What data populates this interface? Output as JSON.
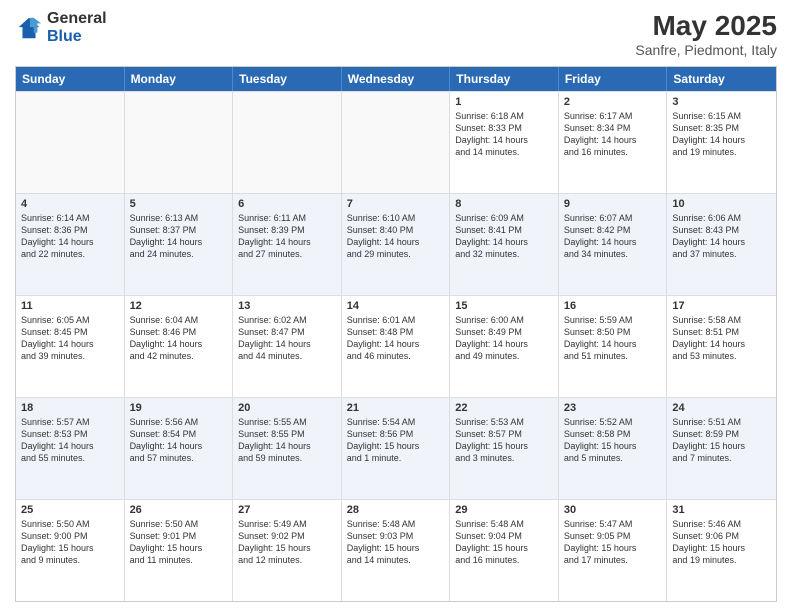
{
  "logo": {
    "general": "General",
    "blue": "Blue"
  },
  "title": "May 2025",
  "subtitle": "Sanfre, Piedmont, Italy",
  "headers": [
    "Sunday",
    "Monday",
    "Tuesday",
    "Wednesday",
    "Thursday",
    "Friday",
    "Saturday"
  ],
  "rows": [
    [
      {
        "day": "",
        "text": ""
      },
      {
        "day": "",
        "text": ""
      },
      {
        "day": "",
        "text": ""
      },
      {
        "day": "",
        "text": ""
      },
      {
        "day": "1",
        "text": "Sunrise: 6:18 AM\nSunset: 8:33 PM\nDaylight: 14 hours\nand 14 minutes."
      },
      {
        "day": "2",
        "text": "Sunrise: 6:17 AM\nSunset: 8:34 PM\nDaylight: 14 hours\nand 16 minutes."
      },
      {
        "day": "3",
        "text": "Sunrise: 6:15 AM\nSunset: 8:35 PM\nDaylight: 14 hours\nand 19 minutes."
      }
    ],
    [
      {
        "day": "4",
        "text": "Sunrise: 6:14 AM\nSunset: 8:36 PM\nDaylight: 14 hours\nand 22 minutes."
      },
      {
        "day": "5",
        "text": "Sunrise: 6:13 AM\nSunset: 8:37 PM\nDaylight: 14 hours\nand 24 minutes."
      },
      {
        "day": "6",
        "text": "Sunrise: 6:11 AM\nSunset: 8:39 PM\nDaylight: 14 hours\nand 27 minutes."
      },
      {
        "day": "7",
        "text": "Sunrise: 6:10 AM\nSunset: 8:40 PM\nDaylight: 14 hours\nand 29 minutes."
      },
      {
        "day": "8",
        "text": "Sunrise: 6:09 AM\nSunset: 8:41 PM\nDaylight: 14 hours\nand 32 minutes."
      },
      {
        "day": "9",
        "text": "Sunrise: 6:07 AM\nSunset: 8:42 PM\nDaylight: 14 hours\nand 34 minutes."
      },
      {
        "day": "10",
        "text": "Sunrise: 6:06 AM\nSunset: 8:43 PM\nDaylight: 14 hours\nand 37 minutes."
      }
    ],
    [
      {
        "day": "11",
        "text": "Sunrise: 6:05 AM\nSunset: 8:45 PM\nDaylight: 14 hours\nand 39 minutes."
      },
      {
        "day": "12",
        "text": "Sunrise: 6:04 AM\nSunset: 8:46 PM\nDaylight: 14 hours\nand 42 minutes."
      },
      {
        "day": "13",
        "text": "Sunrise: 6:02 AM\nSunset: 8:47 PM\nDaylight: 14 hours\nand 44 minutes."
      },
      {
        "day": "14",
        "text": "Sunrise: 6:01 AM\nSunset: 8:48 PM\nDaylight: 14 hours\nand 46 minutes."
      },
      {
        "day": "15",
        "text": "Sunrise: 6:00 AM\nSunset: 8:49 PM\nDaylight: 14 hours\nand 49 minutes."
      },
      {
        "day": "16",
        "text": "Sunrise: 5:59 AM\nSunset: 8:50 PM\nDaylight: 14 hours\nand 51 minutes."
      },
      {
        "day": "17",
        "text": "Sunrise: 5:58 AM\nSunset: 8:51 PM\nDaylight: 14 hours\nand 53 minutes."
      }
    ],
    [
      {
        "day": "18",
        "text": "Sunrise: 5:57 AM\nSunset: 8:53 PM\nDaylight: 14 hours\nand 55 minutes."
      },
      {
        "day": "19",
        "text": "Sunrise: 5:56 AM\nSunset: 8:54 PM\nDaylight: 14 hours\nand 57 minutes."
      },
      {
        "day": "20",
        "text": "Sunrise: 5:55 AM\nSunset: 8:55 PM\nDaylight: 14 hours\nand 59 minutes."
      },
      {
        "day": "21",
        "text": "Sunrise: 5:54 AM\nSunset: 8:56 PM\nDaylight: 15 hours\nand 1 minute."
      },
      {
        "day": "22",
        "text": "Sunrise: 5:53 AM\nSunset: 8:57 PM\nDaylight: 15 hours\nand 3 minutes."
      },
      {
        "day": "23",
        "text": "Sunrise: 5:52 AM\nSunset: 8:58 PM\nDaylight: 15 hours\nand 5 minutes."
      },
      {
        "day": "24",
        "text": "Sunrise: 5:51 AM\nSunset: 8:59 PM\nDaylight: 15 hours\nand 7 minutes."
      }
    ],
    [
      {
        "day": "25",
        "text": "Sunrise: 5:50 AM\nSunset: 9:00 PM\nDaylight: 15 hours\nand 9 minutes."
      },
      {
        "day": "26",
        "text": "Sunrise: 5:50 AM\nSunset: 9:01 PM\nDaylight: 15 hours\nand 11 minutes."
      },
      {
        "day": "27",
        "text": "Sunrise: 5:49 AM\nSunset: 9:02 PM\nDaylight: 15 hours\nand 12 minutes."
      },
      {
        "day": "28",
        "text": "Sunrise: 5:48 AM\nSunset: 9:03 PM\nDaylight: 15 hours\nand 14 minutes."
      },
      {
        "day": "29",
        "text": "Sunrise: 5:48 AM\nSunset: 9:04 PM\nDaylight: 15 hours\nand 16 minutes."
      },
      {
        "day": "30",
        "text": "Sunrise: 5:47 AM\nSunset: 9:05 PM\nDaylight: 15 hours\nand 17 minutes."
      },
      {
        "day": "31",
        "text": "Sunrise: 5:46 AM\nSunset: 9:06 PM\nDaylight: 15 hours\nand 19 minutes."
      }
    ]
  ],
  "alt_rows": [
    1,
    3
  ]
}
